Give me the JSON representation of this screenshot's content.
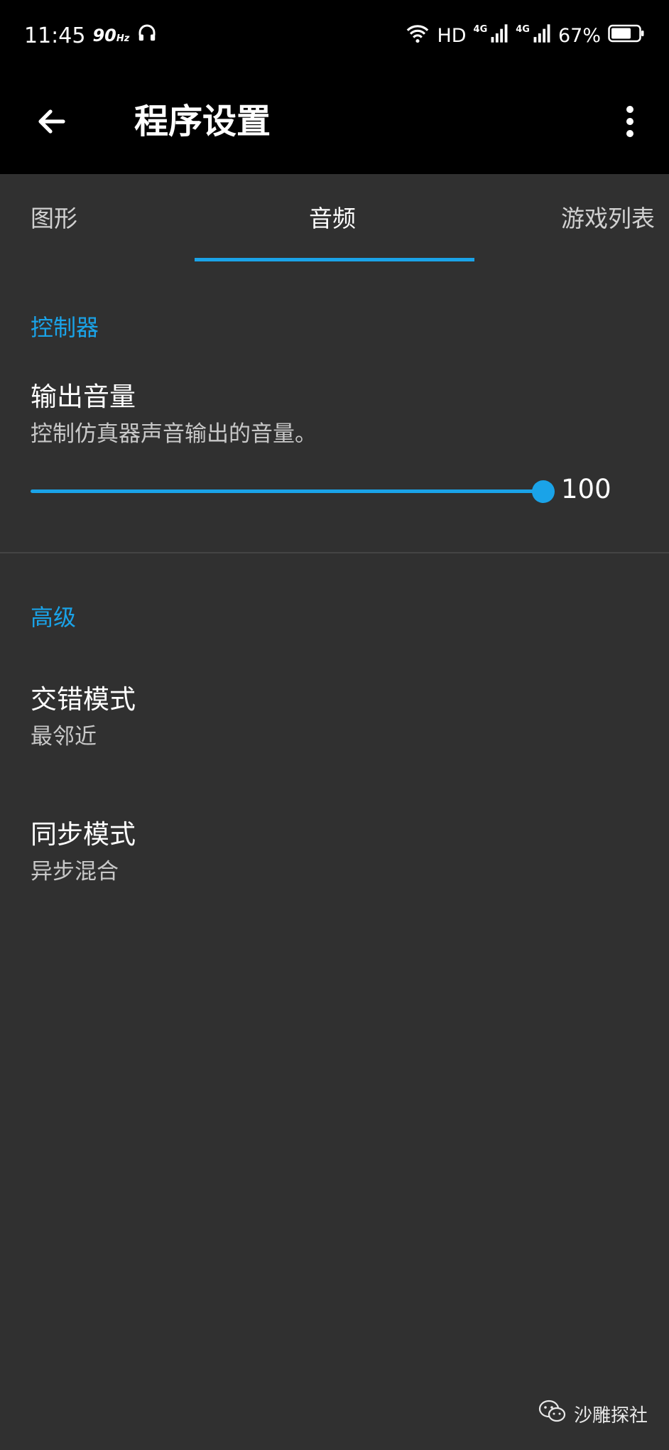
{
  "status_bar": {
    "time": "11:45",
    "refresh_rate": "90",
    "refresh_unit": "Hz",
    "hd_label": "HD",
    "signal1_label": "4G",
    "signal2_label": "4G",
    "battery": "67%",
    "icons": [
      "headphones-icon",
      "wifi-icon",
      "signal-icon",
      "battery-icon"
    ]
  },
  "app_bar": {
    "title": "程序设置",
    "back_icon": "arrow-left-icon",
    "more_icon": "more-vertical-icon"
  },
  "tabs": [
    {
      "label": "图形",
      "active": false
    },
    {
      "label": "音频",
      "active": true
    },
    {
      "label": "游戏列表",
      "active": false
    }
  ],
  "sections": {
    "controller": {
      "header": "控制器",
      "output_volume": {
        "title": "输出音量",
        "summary": "控制仿真器声音输出的音量。",
        "value": "100"
      }
    },
    "advanced": {
      "header": "高级",
      "interleave_mode": {
        "title": "交错模式",
        "summary": "最邻近"
      },
      "sync_mode": {
        "title": "同步模式",
        "summary": "异步混合"
      }
    }
  },
  "watermark": {
    "text": "沙雕探社",
    "icon": "wechat-icon"
  },
  "colors": {
    "accent": "#1aa3e8",
    "background": "#303030",
    "app_bar": "#000000"
  }
}
